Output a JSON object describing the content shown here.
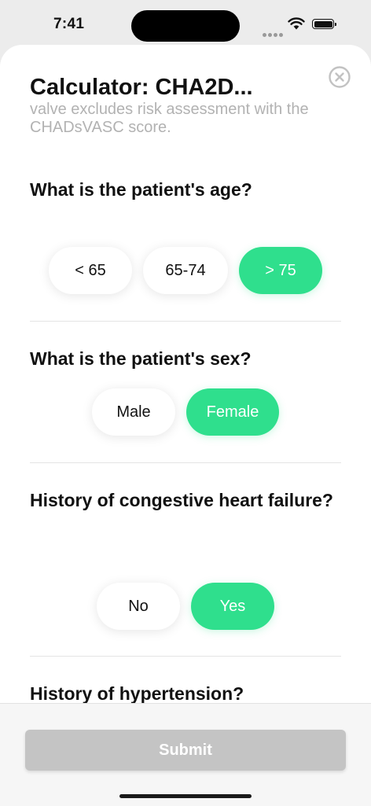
{
  "status_bar": {
    "time": "7:41"
  },
  "header": {
    "title": "Calculator: CHA2D...",
    "subtitle": "valve excludes risk assessment with the CHADsVASC score."
  },
  "questions": [
    {
      "text": "What is the patient's age?",
      "options": [
        "< 65",
        "65-74",
        "> 75"
      ],
      "selected": "> 75"
    },
    {
      "text": "What is the patient's sex?",
      "options": [
        "Male",
        "Female"
      ],
      "selected": "Female"
    },
    {
      "text": "History of congestive heart failure?",
      "options": [
        "No",
        "Yes"
      ],
      "selected": "Yes"
    },
    {
      "text": "History of hypertension?"
    }
  ],
  "footer": {
    "submit_label": "Submit"
  },
  "colors": {
    "accent": "#2fdf8d",
    "submit_disabled": "#c4c4c4",
    "subtitle": "#b2b2b2"
  },
  "icons": [
    "close-icon",
    "wifi-icon",
    "battery-icon",
    "cellular-signal-icon"
  ]
}
